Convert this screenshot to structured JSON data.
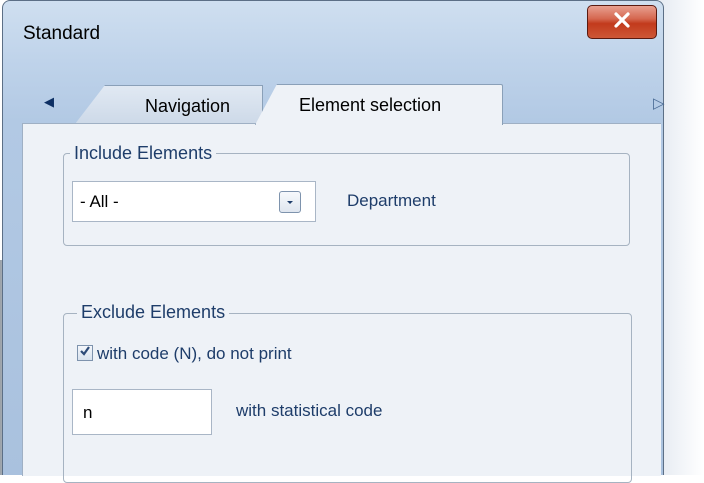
{
  "window": {
    "title": "Standard",
    "close_icon": "close-icon"
  },
  "tabs": {
    "scroll_left_icon": "◀",
    "scroll_right_icon": "▷",
    "items": [
      {
        "label": "Navigation",
        "selected": false
      },
      {
        "label": "Element selection",
        "selected": true
      }
    ]
  },
  "include": {
    "legend": "Include Elements",
    "selected_value": "- All -",
    "dropdown_icon": "chevron-down-icon",
    "field_label": "Department"
  },
  "exclude": {
    "legend": "Exclude Elements",
    "checkbox_label": "with code (N), do not print",
    "checkbox_checked": true,
    "code_value": "n",
    "code_label": "with statistical code"
  },
  "colors": {
    "accent_text": "#1e3d6a",
    "close_button": "#c23a1c",
    "panel": "#eef2f7"
  }
}
